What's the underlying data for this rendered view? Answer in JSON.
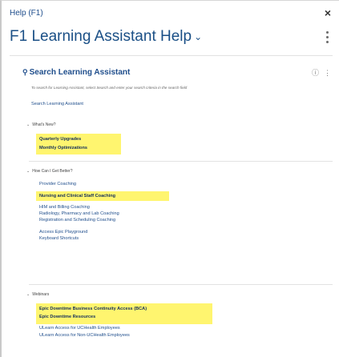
{
  "window": {
    "title": "Help (F1)",
    "close_glyph": "×"
  },
  "header": {
    "title": "F1 Learning Assistant Help",
    "chevron_icon": "chevron-down-icon",
    "menu_icon": "vertical-ellipsis-icon"
  },
  "search": {
    "heading": "Search Learning Assistant",
    "heading_icon": "search-icon",
    "instructions": "To search for Learning Assistant, select Search and enter your search criteria in the search field",
    "link": "Search Learning Assistant",
    "side_icons": [
      "info-icon",
      "vertical-ellipsis-icon"
    ]
  },
  "sections": [
    {
      "label": "What's New?",
      "items": [
        "Quarterly Upgrades",
        "Monthly Optimizations"
      ]
    },
    {
      "label": "How Can I Get Better?",
      "items": [
        "Provider Coaching",
        "Nursing and Clinical Staff Coaching",
        "HIM and Billing Coaching",
        "Radiology, Pharmacy and Lab Coaching",
        "Registration and Scheduling Coaching",
        "Access Epic Playground",
        "Keyboard Shortcuts"
      ]
    },
    {
      "label": "Webinars",
      "items": [
        "Epic Downtime Business Continuity Access (BCA)",
        "Epic Downtime Resources",
        "ULearn Access for UCHealth Employees",
        "ULearn Access for Non-UCHealth Employees"
      ]
    }
  ],
  "colors": {
    "highlight": "#fff56f",
    "link": "#1f4e8c",
    "title": "#1a4f86"
  }
}
